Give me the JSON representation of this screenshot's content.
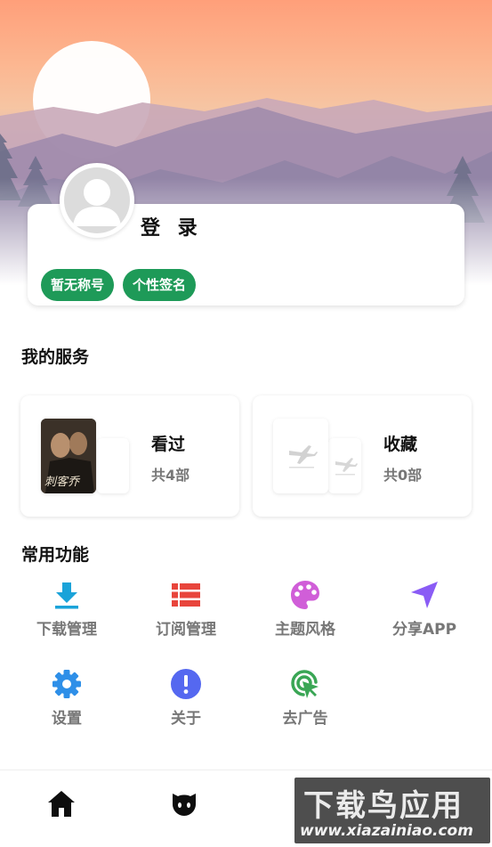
{
  "profile": {
    "login_label": "登 录",
    "tags": [
      "暂无称号",
      "个性签名"
    ]
  },
  "services": {
    "title": "我的服务",
    "items": [
      {
        "title": "看过",
        "count": "共4部",
        "poster_text": "刺客乔"
      },
      {
        "title": "收藏",
        "count": "共0部"
      }
    ]
  },
  "functions": {
    "title": "常用功能",
    "items": [
      {
        "label": "下载管理",
        "icon": "download-icon",
        "color": "#1aa3d9"
      },
      {
        "label": "订阅管理",
        "icon": "list-icon",
        "color": "#e8453c"
      },
      {
        "label": "主题风格",
        "icon": "palette-icon",
        "color": "#d05ed8"
      },
      {
        "label": "分享APP",
        "icon": "send-icon",
        "color": "#8a5cf5"
      },
      {
        "label": "设置",
        "icon": "gear-icon",
        "color": "#2e8fe8"
      },
      {
        "label": "关于",
        "icon": "info-icon",
        "color": "#5568f0"
      },
      {
        "label": "去广告",
        "icon": "cursor-click-icon",
        "color": "#3aa655"
      }
    ]
  },
  "bottom_nav": {
    "items": [
      {
        "icon": "home-icon"
      },
      {
        "icon": "face-icon"
      }
    ]
  },
  "watermark": {
    "brand": "下载鸟应用",
    "url": "www.xiazainiao.com"
  }
}
